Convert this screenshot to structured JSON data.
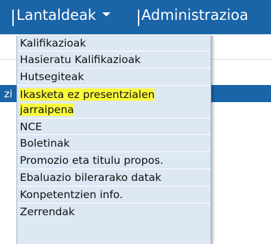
{
  "menubar": {
    "items": [
      {
        "label": "Lantaldeak"
      },
      {
        "label": "Administrazioa"
      }
    ]
  },
  "band": {
    "text": "zi"
  },
  "dropdown": {
    "items": [
      {
        "label": "Kalifikazioak"
      },
      {
        "label": "Hasieratu Kalifikazioak"
      },
      {
        "label": "Hutsegiteak"
      },
      {
        "lines": [
          "Ikasketa ez presentzialen",
          "jarraipena"
        ],
        "highlighted": true
      },
      {
        "label": "NCE"
      },
      {
        "label": "Boletinak"
      },
      {
        "label": "Promozio eta titulu propos."
      },
      {
        "label": "Ebaluazio bilerarako datak"
      },
      {
        "label": "Konpetentzien info."
      },
      {
        "label": "Zerrendak"
      }
    ]
  },
  "colors": {
    "menubar_bg": "#1a64a8",
    "dropdown_bg": "#dde8f4",
    "highlight": "#fbfb3b"
  }
}
